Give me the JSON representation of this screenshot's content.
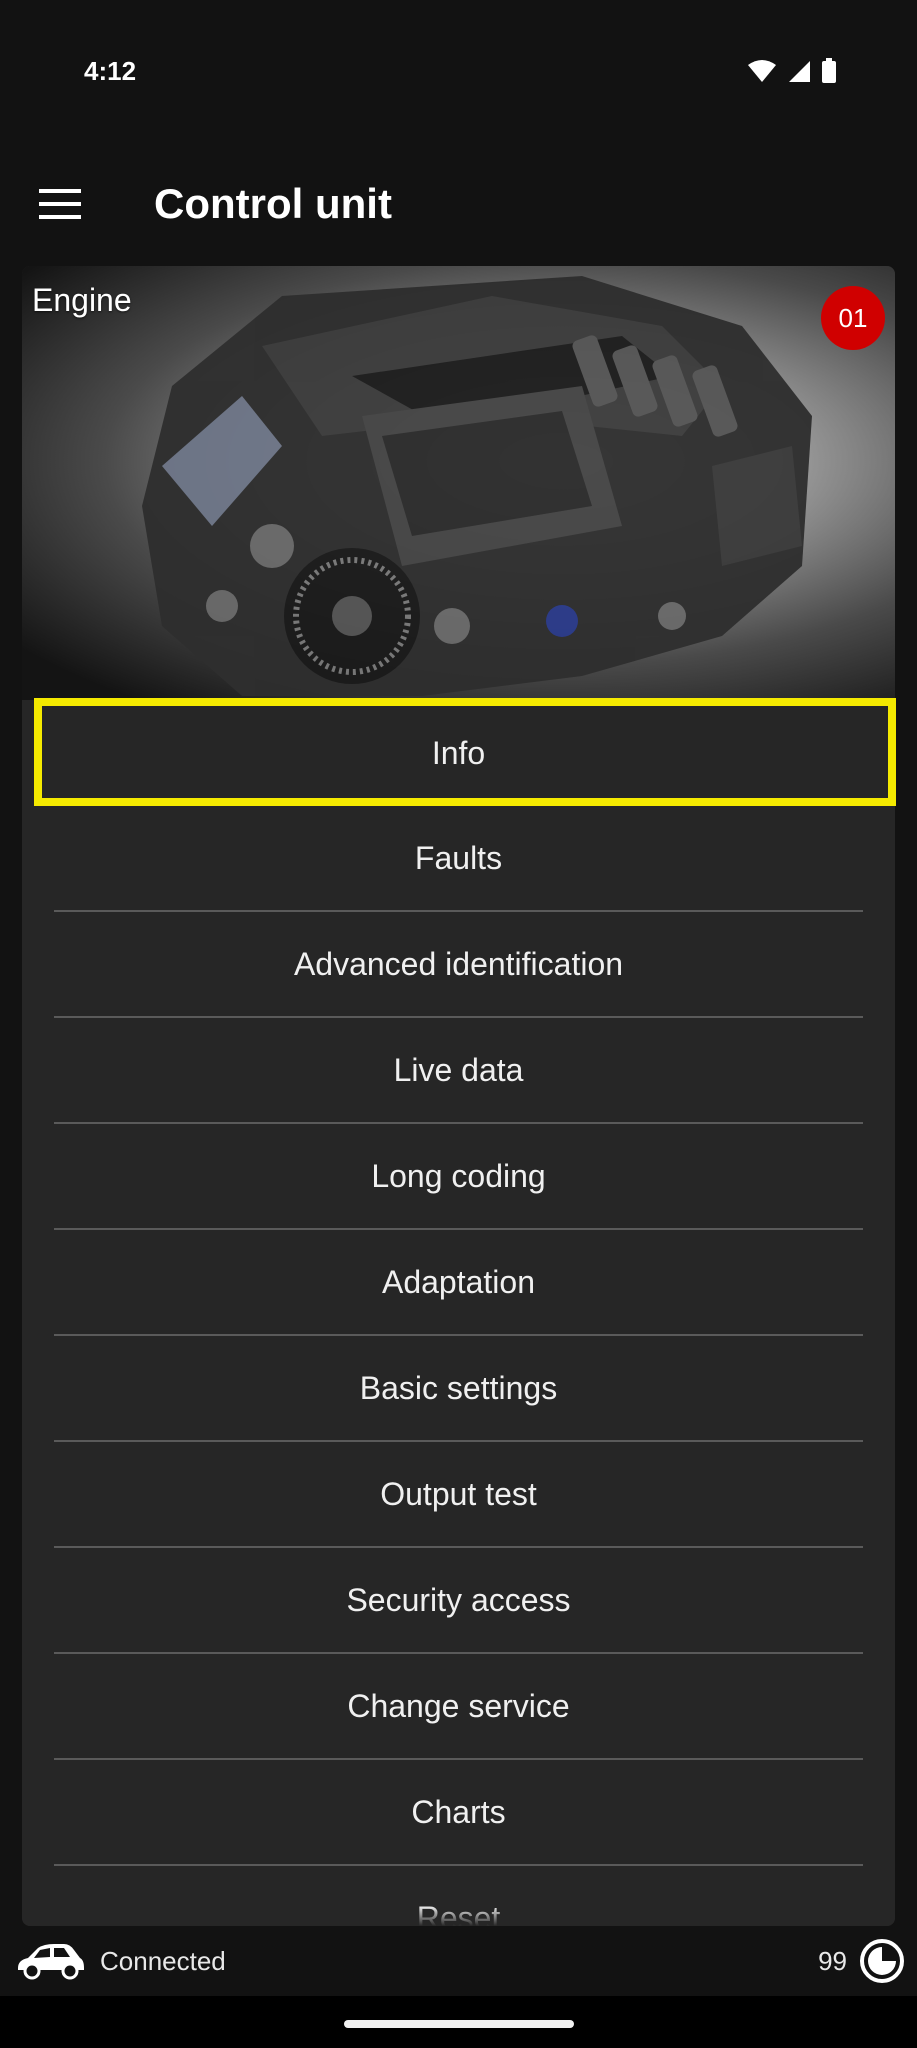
{
  "status_bar": {
    "time": "4:12"
  },
  "app_bar": {
    "title": "Control unit"
  },
  "card": {
    "title": "Engine",
    "badge": "01",
    "menu_items": [
      "Info",
      "Faults",
      "Advanced identification",
      "Live data",
      "Long coding",
      "Adaptation",
      "Basic settings",
      "Output test",
      "Security access",
      "Change service",
      "Charts",
      "Reset"
    ]
  },
  "bottom_bar": {
    "status": "Connected",
    "counter": "99"
  },
  "colors": {
    "background": "#121212",
    "card": "#262626",
    "badge": "#d00000",
    "highlight": "#f5ea00"
  },
  "icons": {
    "menu": "hamburger-icon",
    "wifi": "wifi-icon",
    "signal": "signal-icon",
    "battery": "battery-icon",
    "car": "car-icon",
    "logo": "app-logo-icon"
  }
}
